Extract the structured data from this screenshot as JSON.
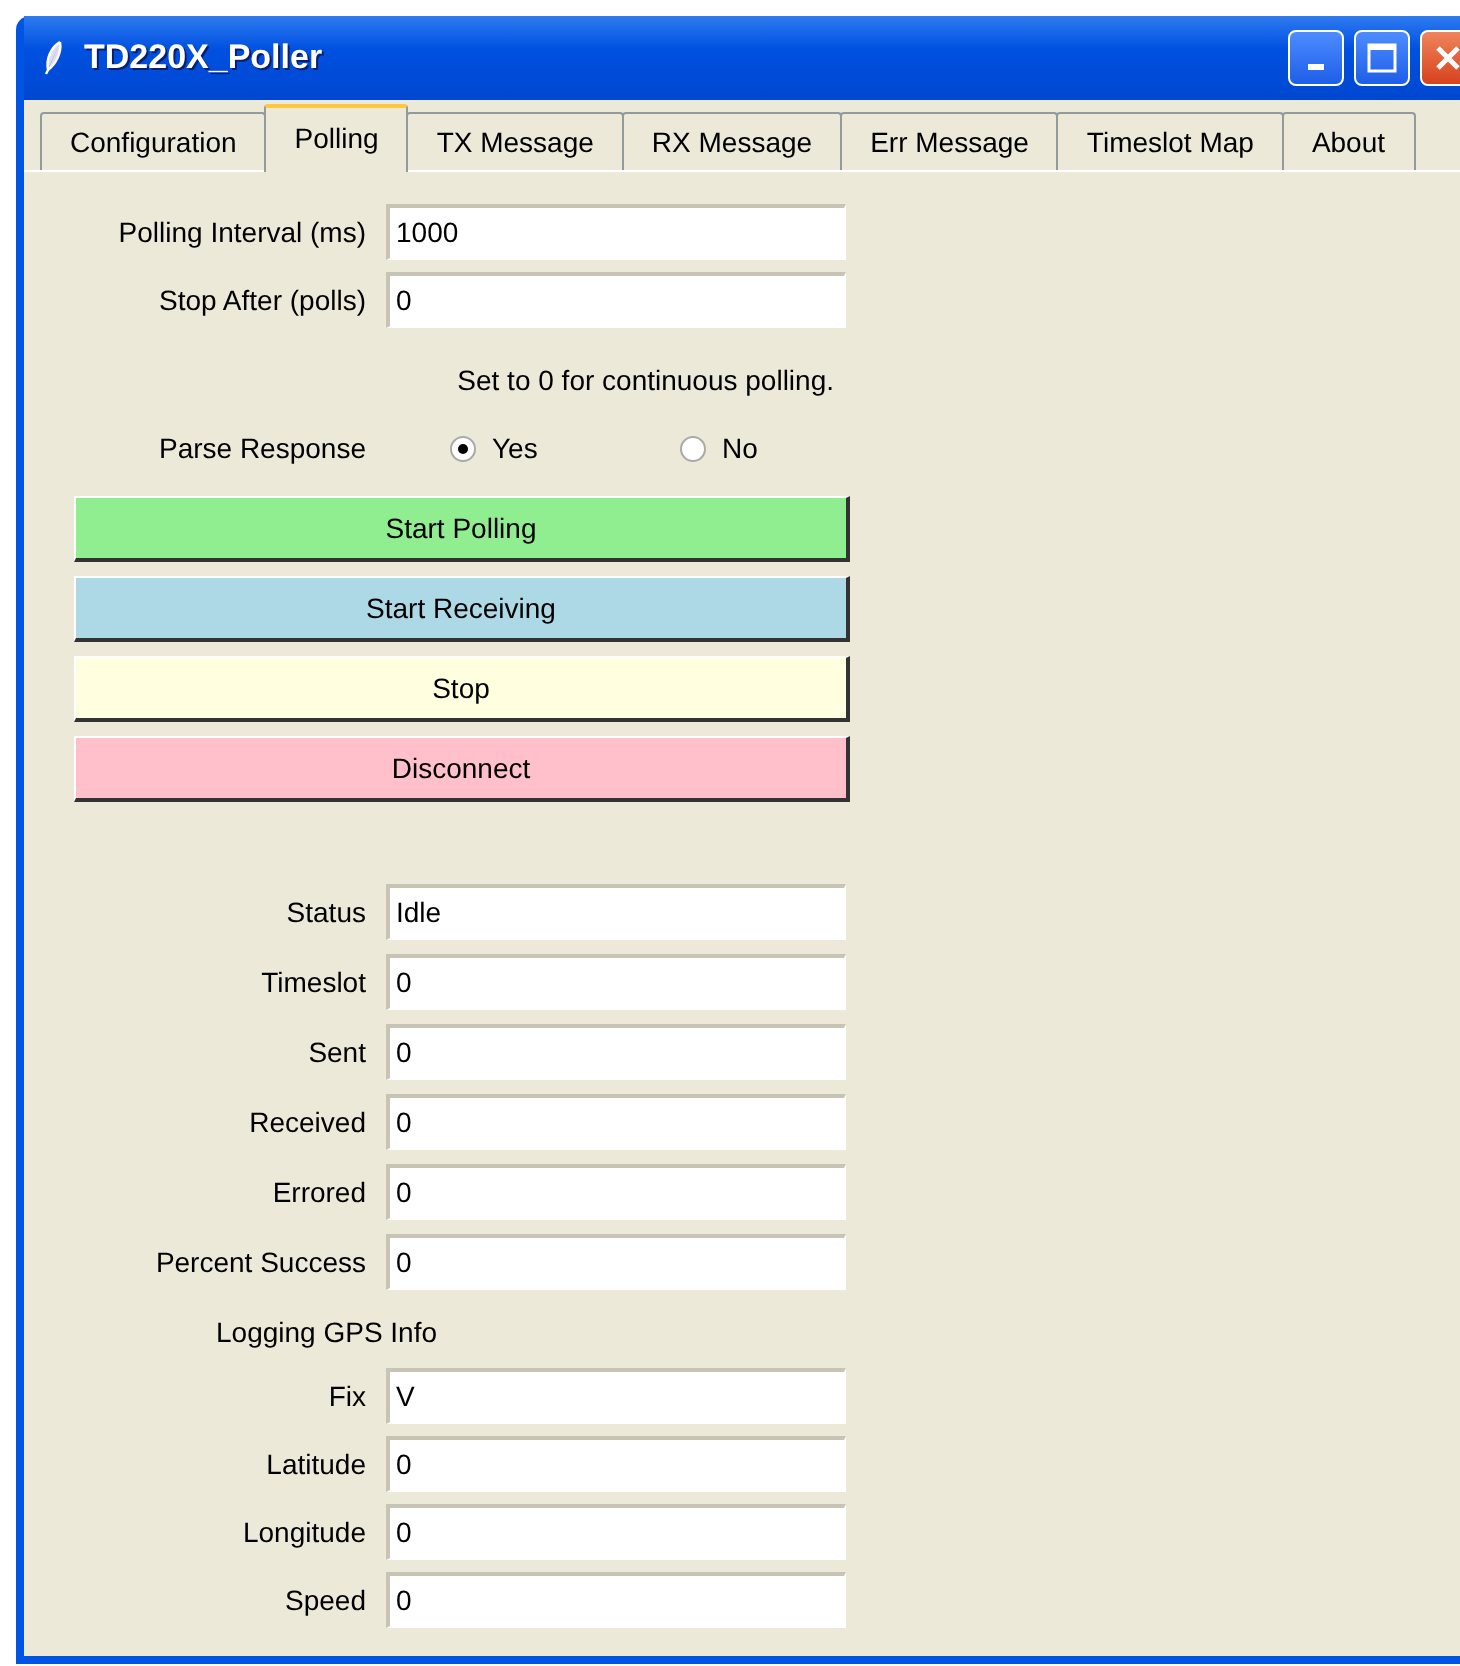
{
  "window": {
    "title": "TD220X_Poller"
  },
  "tabs": [
    {
      "label": "Configuration",
      "selected": false
    },
    {
      "label": "Polling",
      "selected": true
    },
    {
      "label": "TX Message",
      "selected": false
    },
    {
      "label": "RX Message",
      "selected": false
    },
    {
      "label": "Err Message",
      "selected": false
    },
    {
      "label": "Timeslot Map",
      "selected": false
    },
    {
      "label": "About",
      "selected": false
    }
  ],
  "polling_settings": [
    {
      "label": "Polling Interval (ms)",
      "value": "1000"
    },
    {
      "label": "Stop After (polls)",
      "value": "0"
    }
  ],
  "hint": "Set to 0 for continuous polling.",
  "parse_response": {
    "label": "Parse Response",
    "options": [
      {
        "label": "Yes",
        "selected": true
      },
      {
        "label": "No",
        "selected": false
      }
    ]
  },
  "buttons": [
    {
      "label": "Start Polling",
      "color": "#90ee90"
    },
    {
      "label": "Start Receiving",
      "color": "#add8e6"
    },
    {
      "label": "Stop",
      "color": "#ffffe0"
    },
    {
      "label": "Disconnect",
      "color": "#ffc0cb"
    }
  ],
  "statistics": [
    {
      "label": "Status",
      "value": "Idle"
    },
    {
      "label": "Timeslot",
      "value": "0"
    },
    {
      "label": "Sent",
      "value": "0"
    },
    {
      "label": "Received",
      "value": "0"
    },
    {
      "label": "Errored",
      "value": "0"
    },
    {
      "label": "Percent Success",
      "value": "0"
    }
  ],
  "gps": {
    "heading": "Logging GPS Info",
    "fields": [
      {
        "label": "Fix",
        "value": "V"
      },
      {
        "label": "Latitude",
        "value": "0"
      },
      {
        "label": "Longitude",
        "value": "0"
      },
      {
        "label": "Speed",
        "value": "0"
      }
    ]
  }
}
